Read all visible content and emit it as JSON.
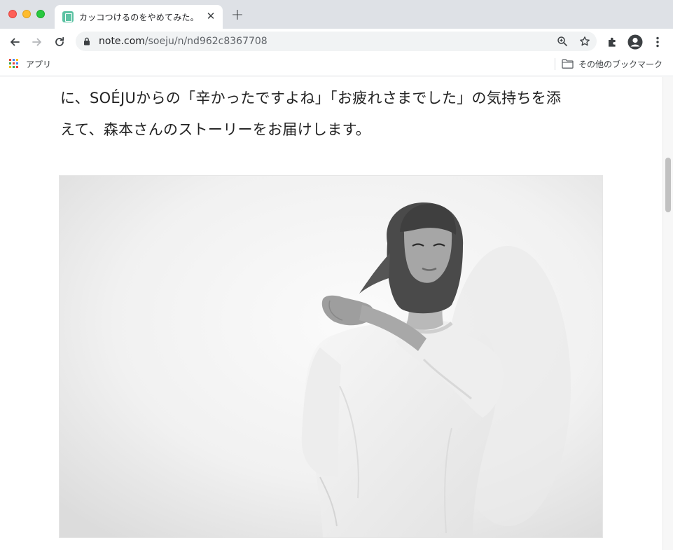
{
  "browser": {
    "tab": {
      "title": "カッコつけるのをやめてみた。"
    },
    "url": {
      "domain": "note.com",
      "path": "/soeju/n/nd962c8367708"
    },
    "bookmarks_bar": {
      "apps_label": "アプリ",
      "other_label": "その他のブックマーク"
    }
  },
  "article": {
    "paragraph_line1": "に、SOÉJUからの「辛かったですよね」「お疲れさまでした」の気持ちを添",
    "paragraph_line2": "えて、森本さんのストーリーをお届けします。"
  },
  "colors": {
    "tab_strip": "#dee1e6",
    "favicon": "#5ec3a4",
    "text": "#222222"
  },
  "icons": [
    "close-icon",
    "new-tab-icon",
    "back-icon",
    "forward-icon",
    "reload-icon",
    "lock-icon",
    "zoom-icon",
    "star-icon",
    "extensions-icon",
    "profile-icon",
    "menu-icon",
    "apps-icon",
    "folder-icon"
  ]
}
